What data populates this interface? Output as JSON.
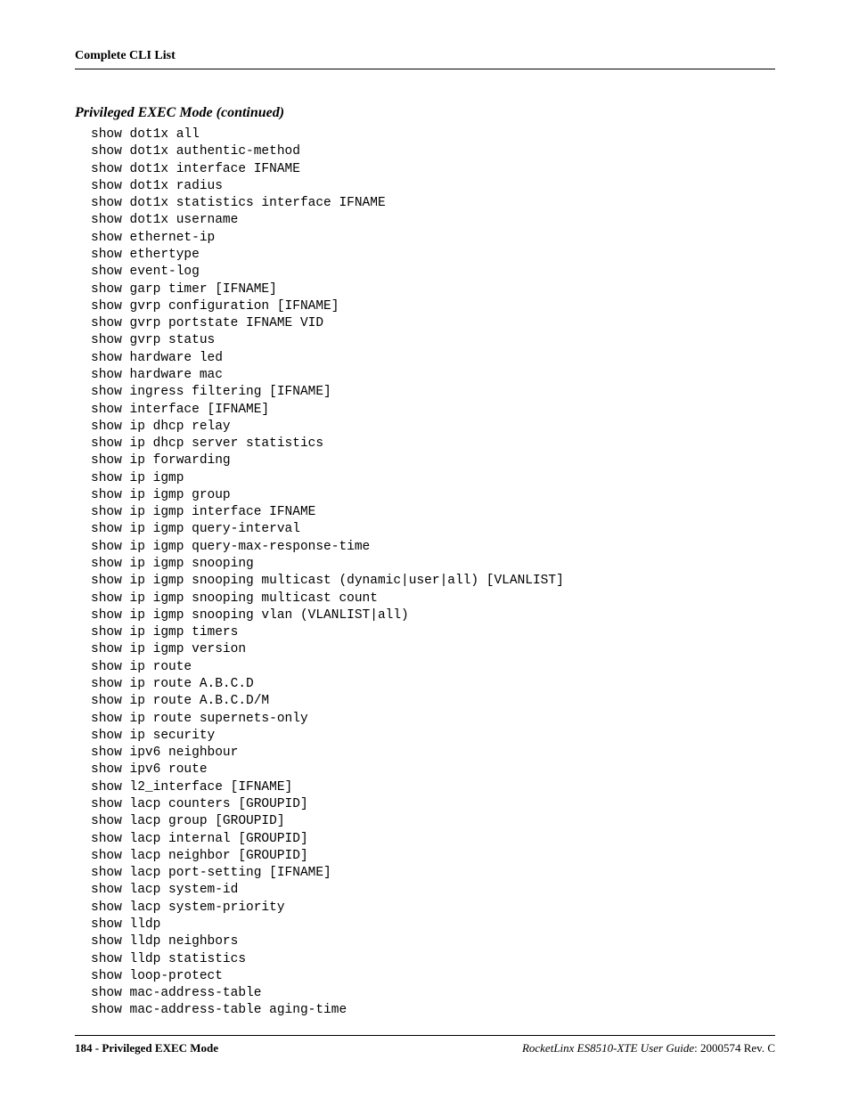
{
  "header": {
    "title": "Complete CLI List"
  },
  "section": {
    "title": "Privileged EXEC Mode (continued)"
  },
  "commands": [
    "show dot1x all",
    "show dot1x authentic-method",
    "show dot1x interface IFNAME",
    "show dot1x radius",
    "show dot1x statistics interface IFNAME",
    "show dot1x username",
    "show ethernet-ip",
    "show ethertype",
    "show event-log",
    "show garp timer [IFNAME]",
    "show gvrp configuration [IFNAME]",
    "show gvrp portstate IFNAME VID",
    "show gvrp status",
    "show hardware led",
    "show hardware mac",
    "show ingress filtering [IFNAME]",
    "show interface [IFNAME]",
    "show ip dhcp relay",
    "show ip dhcp server statistics",
    "show ip forwarding",
    "show ip igmp",
    "show ip igmp group",
    "show ip igmp interface IFNAME",
    "show ip igmp query-interval",
    "show ip igmp query-max-response-time",
    "show ip igmp snooping",
    "show ip igmp snooping multicast (dynamic|user|all) [VLANLIST]",
    "show ip igmp snooping multicast count",
    "show ip igmp snooping vlan (VLANLIST|all)",
    "show ip igmp timers",
    "show ip igmp version",
    "show ip route",
    "show ip route A.B.C.D",
    "show ip route A.B.C.D/M",
    "show ip route supernets-only",
    "show ip security",
    "show ipv6 neighbour",
    "show ipv6 route",
    "show l2_interface [IFNAME]",
    "show lacp counters [GROUPID]",
    "show lacp group [GROUPID]",
    "show lacp internal [GROUPID]",
    "show lacp neighbor [GROUPID]",
    "show lacp port-setting [IFNAME]",
    "show lacp system-id",
    "show lacp system-priority",
    "show lldp",
    "show lldp neighbors",
    "show lldp statistics",
    "show loop-protect",
    "show mac-address-table",
    "show mac-address-table aging-time"
  ],
  "footer": {
    "page_label": "184 - Privileged EXEC Mode",
    "guide_name": "RocketLinx ES8510-XTE User Guide",
    "revision": ": 2000574 Rev. C"
  }
}
